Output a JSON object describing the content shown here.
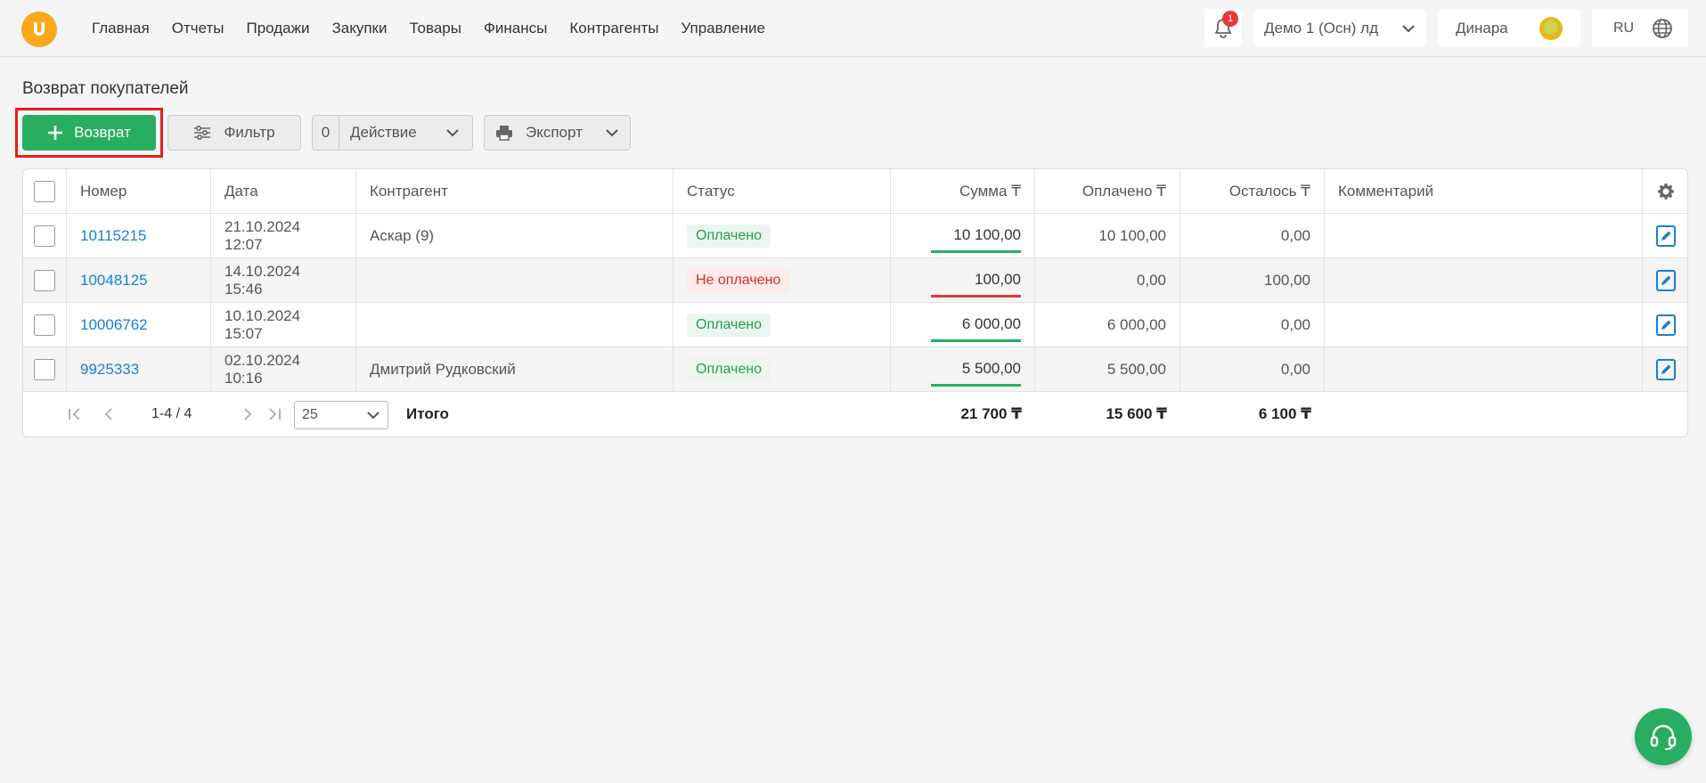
{
  "nav": [
    "Главная",
    "Отчеты",
    "Продажи",
    "Закупки",
    "Товары",
    "Финансы",
    "Контрагенты",
    "Управление"
  ],
  "header": {
    "notification_count": "1",
    "company": "Демо 1 (Осн) лд",
    "user": "Динара",
    "lang": "RU"
  },
  "page": {
    "title": "Возврат покупателей"
  },
  "toolbar": {
    "add_label": "Возврат",
    "filter_label": "Фильтр",
    "action_count": "0",
    "action_label": "Действие",
    "export_label": "Экспорт"
  },
  "table": {
    "headers": {
      "number": "Номер",
      "date": "Дата",
      "contractor": "Контрагент",
      "status": "Статус",
      "sum": "Сумма ₸",
      "paid": "Оплачено ₸",
      "left": "Осталось ₸",
      "comment": "Комментарий"
    },
    "rows": [
      {
        "number": "10115215",
        "date": "21.10.2024",
        "time": "12:07",
        "contractor": "Аскар (9)",
        "status": "Оплачено",
        "sum": "10 100,00",
        "paid": "10 100,00",
        "left": "0,00",
        "comment": ""
      },
      {
        "number": "10048125",
        "date": "14.10.2024",
        "time": "15:46",
        "contractor": "",
        "status": "Не оплачено",
        "sum": "100,00",
        "paid": "0,00",
        "left": "100,00",
        "comment": ""
      },
      {
        "number": "10006762",
        "date": "10.10.2024",
        "time": "15:07",
        "contractor": "",
        "status": "Оплачено",
        "sum": "6 000,00",
        "paid": "6 000,00",
        "left": "0,00",
        "comment": ""
      },
      {
        "number": "9925333",
        "date": "02.10.2024",
        "time": "10:16",
        "contractor": "Дмитрий Рудковский",
        "status": "Оплачено",
        "sum": "5 500,00",
        "paid": "5 500,00",
        "left": "0,00",
        "comment": ""
      }
    ],
    "footer": {
      "range": "1-4 / 4",
      "per_page": "25",
      "total_label": "Итого",
      "total_sum": "21 700 ₸",
      "total_paid": "15 600 ₸",
      "total_left": "6 100 ₸"
    }
  },
  "colors": {
    "accent": "#27ae60",
    "link": "#1a7fd0",
    "paid": "#2a9d4e",
    "unpaid": "#d32f2f",
    "logo": "#f7a81b"
  }
}
